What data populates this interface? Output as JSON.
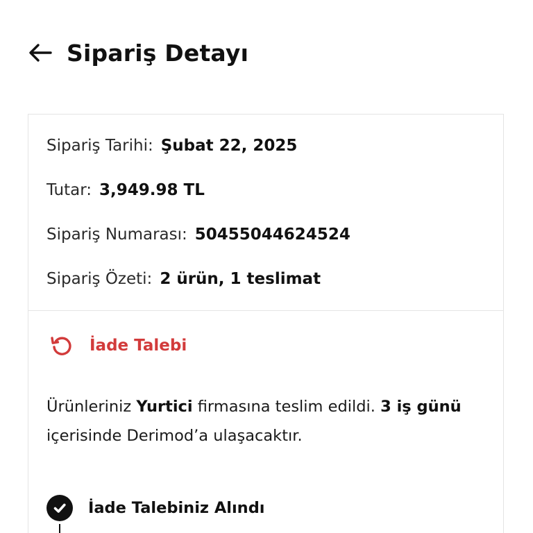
{
  "header": {
    "title": "Sipariş Detayı",
    "back_icon": "arrow-left-icon"
  },
  "order": {
    "date_label": "Sipariş Tarihi:",
    "date_value": "Şubat 22, 2025",
    "amount_label": "Tutar:",
    "amount_value": "3,949.98 TL",
    "number_label": "Sipariş Numarası:",
    "number_value": "50455044624524",
    "summary_label": "Sipariş Özeti:",
    "summary_value": "2 ürün, 1 teslimat"
  },
  "return_request": {
    "label": "İade Talebi",
    "icon": "refresh-icon",
    "color": "#d23b3b"
  },
  "message": {
    "part1": "Ürünleriniz ",
    "carrier": "Yurtici",
    "part2": " firmasına teslim edildi. ",
    "duration": "3 iş günü",
    "part3": " içerisinde Derimod’a ulaşacaktır."
  },
  "timeline": {
    "steps": [
      {
        "label": "İade Talebiniz Alındı",
        "icon": "check-circle-icon",
        "status": "completed"
      }
    ]
  }
}
